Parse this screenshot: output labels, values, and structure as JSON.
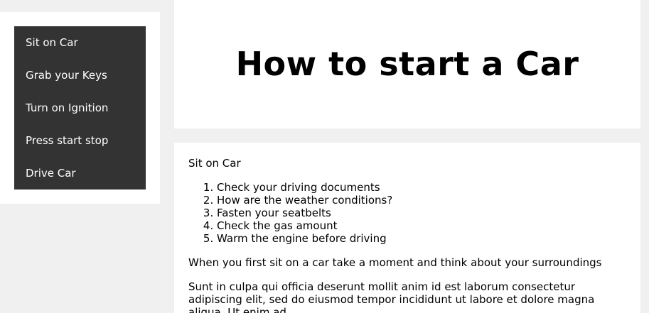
{
  "sidebar": {
    "items": [
      {
        "label": "Sit on Car"
      },
      {
        "label": "Grab your Keys"
      },
      {
        "label": "Turn on Ignition"
      },
      {
        "label": "Press start stop"
      },
      {
        "label": "Drive Car"
      }
    ]
  },
  "header": {
    "title": "How to start a Car"
  },
  "content": {
    "section_heading": "Sit on Car",
    "steps": [
      "Check your driving documents",
      "How are the weather conditions?",
      "Fasten your seatbelts",
      "Check the gas amount",
      "Warm the engine before driving"
    ],
    "intro_paragraph": "When you first sit on a car take a moment and think about your surroundings",
    "body_paragraph": "Sunt in culpa qui officia deserunt mollit anim id est laborum consectetur adipiscing elit, sed do eiusmod tempor incididunt ut labore et dolore magna aliqua. Ut enim ad"
  },
  "colors": {
    "page_background": "#f0f0f0",
    "panel_background": "#ffffff",
    "nav_background": "#333333",
    "nav_text": "#ffffff"
  }
}
